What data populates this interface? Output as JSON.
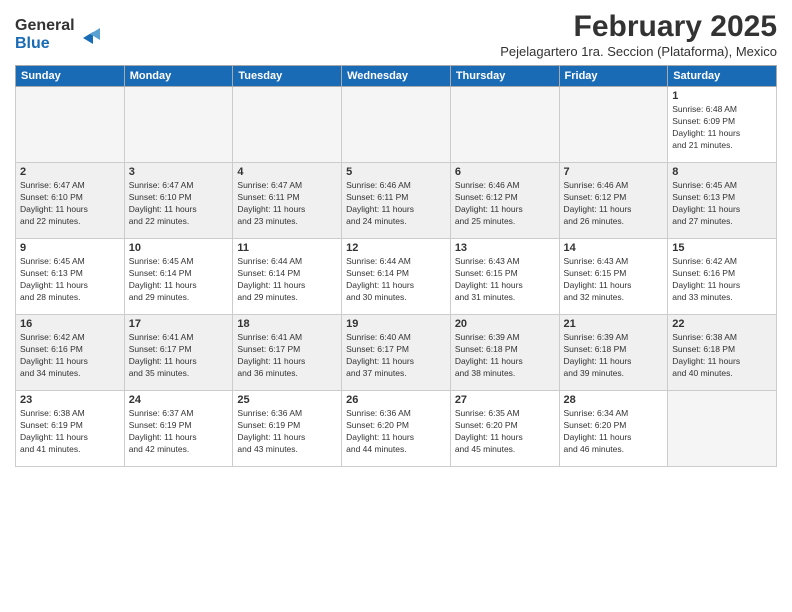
{
  "header": {
    "logo_line1": "General",
    "logo_line2": "Blue",
    "month_year": "February 2025",
    "location": "Pejelagartero 1ra. Seccion (Plataforma), Mexico"
  },
  "weekdays": [
    "Sunday",
    "Monday",
    "Tuesday",
    "Wednesday",
    "Thursday",
    "Friday",
    "Saturday"
  ],
  "weeks": [
    {
      "shaded": false,
      "days": [
        {
          "num": "",
          "info": ""
        },
        {
          "num": "",
          "info": ""
        },
        {
          "num": "",
          "info": ""
        },
        {
          "num": "",
          "info": ""
        },
        {
          "num": "",
          "info": ""
        },
        {
          "num": "",
          "info": ""
        },
        {
          "num": "1",
          "info": "Sunrise: 6:48 AM\nSunset: 6:09 PM\nDaylight: 11 hours\nand 21 minutes."
        }
      ]
    },
    {
      "shaded": true,
      "days": [
        {
          "num": "2",
          "info": "Sunrise: 6:47 AM\nSunset: 6:10 PM\nDaylight: 11 hours\nand 22 minutes."
        },
        {
          "num": "3",
          "info": "Sunrise: 6:47 AM\nSunset: 6:10 PM\nDaylight: 11 hours\nand 22 minutes."
        },
        {
          "num": "4",
          "info": "Sunrise: 6:47 AM\nSunset: 6:11 PM\nDaylight: 11 hours\nand 23 minutes."
        },
        {
          "num": "5",
          "info": "Sunrise: 6:46 AM\nSunset: 6:11 PM\nDaylight: 11 hours\nand 24 minutes."
        },
        {
          "num": "6",
          "info": "Sunrise: 6:46 AM\nSunset: 6:12 PM\nDaylight: 11 hours\nand 25 minutes."
        },
        {
          "num": "7",
          "info": "Sunrise: 6:46 AM\nSunset: 6:12 PM\nDaylight: 11 hours\nand 26 minutes."
        },
        {
          "num": "8",
          "info": "Sunrise: 6:45 AM\nSunset: 6:13 PM\nDaylight: 11 hours\nand 27 minutes."
        }
      ]
    },
    {
      "shaded": false,
      "days": [
        {
          "num": "9",
          "info": "Sunrise: 6:45 AM\nSunset: 6:13 PM\nDaylight: 11 hours\nand 28 minutes."
        },
        {
          "num": "10",
          "info": "Sunrise: 6:45 AM\nSunset: 6:14 PM\nDaylight: 11 hours\nand 29 minutes."
        },
        {
          "num": "11",
          "info": "Sunrise: 6:44 AM\nSunset: 6:14 PM\nDaylight: 11 hours\nand 29 minutes."
        },
        {
          "num": "12",
          "info": "Sunrise: 6:44 AM\nSunset: 6:14 PM\nDaylight: 11 hours\nand 30 minutes."
        },
        {
          "num": "13",
          "info": "Sunrise: 6:43 AM\nSunset: 6:15 PM\nDaylight: 11 hours\nand 31 minutes."
        },
        {
          "num": "14",
          "info": "Sunrise: 6:43 AM\nSunset: 6:15 PM\nDaylight: 11 hours\nand 32 minutes."
        },
        {
          "num": "15",
          "info": "Sunrise: 6:42 AM\nSunset: 6:16 PM\nDaylight: 11 hours\nand 33 minutes."
        }
      ]
    },
    {
      "shaded": true,
      "days": [
        {
          "num": "16",
          "info": "Sunrise: 6:42 AM\nSunset: 6:16 PM\nDaylight: 11 hours\nand 34 minutes."
        },
        {
          "num": "17",
          "info": "Sunrise: 6:41 AM\nSunset: 6:17 PM\nDaylight: 11 hours\nand 35 minutes."
        },
        {
          "num": "18",
          "info": "Sunrise: 6:41 AM\nSunset: 6:17 PM\nDaylight: 11 hours\nand 36 minutes."
        },
        {
          "num": "19",
          "info": "Sunrise: 6:40 AM\nSunset: 6:17 PM\nDaylight: 11 hours\nand 37 minutes."
        },
        {
          "num": "20",
          "info": "Sunrise: 6:39 AM\nSunset: 6:18 PM\nDaylight: 11 hours\nand 38 minutes."
        },
        {
          "num": "21",
          "info": "Sunrise: 6:39 AM\nSunset: 6:18 PM\nDaylight: 11 hours\nand 39 minutes."
        },
        {
          "num": "22",
          "info": "Sunrise: 6:38 AM\nSunset: 6:18 PM\nDaylight: 11 hours\nand 40 minutes."
        }
      ]
    },
    {
      "shaded": false,
      "days": [
        {
          "num": "23",
          "info": "Sunrise: 6:38 AM\nSunset: 6:19 PM\nDaylight: 11 hours\nand 41 minutes."
        },
        {
          "num": "24",
          "info": "Sunrise: 6:37 AM\nSunset: 6:19 PM\nDaylight: 11 hours\nand 42 minutes."
        },
        {
          "num": "25",
          "info": "Sunrise: 6:36 AM\nSunset: 6:19 PM\nDaylight: 11 hours\nand 43 minutes."
        },
        {
          "num": "26",
          "info": "Sunrise: 6:36 AM\nSunset: 6:20 PM\nDaylight: 11 hours\nand 44 minutes."
        },
        {
          "num": "27",
          "info": "Sunrise: 6:35 AM\nSunset: 6:20 PM\nDaylight: 11 hours\nand 45 minutes."
        },
        {
          "num": "28",
          "info": "Sunrise: 6:34 AM\nSunset: 6:20 PM\nDaylight: 11 hours\nand 46 minutes."
        },
        {
          "num": "",
          "info": ""
        }
      ]
    }
  ]
}
